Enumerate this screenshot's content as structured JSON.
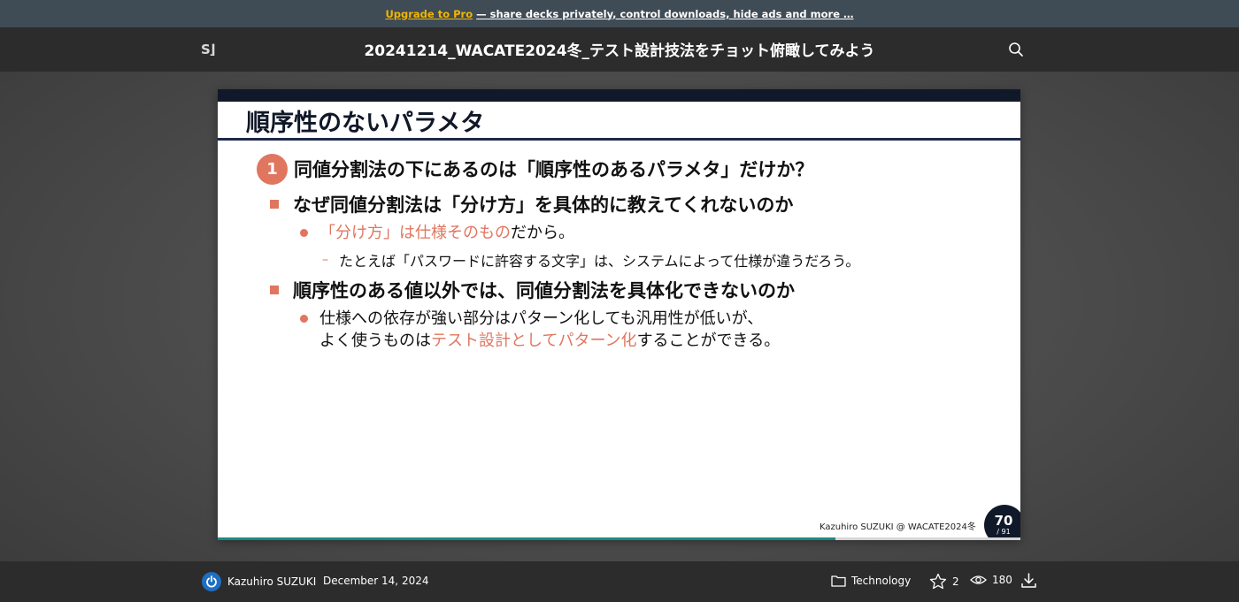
{
  "promo": {
    "upgrade_label": "Upgrade to Pro",
    "rest_label": "— share decks privately, control downloads, hide ads and more …"
  },
  "header": {
    "logo_text": "S⌋",
    "title": "20241214_WACATE2024冬_テスト設計技法をチョット俯瞰してみよう",
    "search_icon": "search-icon"
  },
  "slide": {
    "title": "順序性のないパラメタ",
    "point_number": "1",
    "point_text": "同値分割法の下にあるのは「順序性のあるパラメタ」だけか？",
    "bullet1": "なぜ同値分割法は「分け方」を具体的に教えてくれないのか",
    "bullet1_sub_accent": "「分け方」は仕様そのもの",
    "bullet1_sub_rest": "だから。",
    "bullet1_dash": "–",
    "bullet1_subsub": "たとえば「パスワードに許容する文字」は、システムによって仕様が違うだろう。",
    "bullet2": "順序性のある値以外では、同値分割法を具体化できないのか",
    "bullet2_sub_line1": "仕様への依存が強い部分はパターン化しても汎用性が低いが、",
    "bullet2_sub_line2_pre": "よく使うものは",
    "bullet2_sub_line2_accent": "テスト設計としてパターン化",
    "bullet2_sub_line2_post": "することができる。",
    "footer": "Kazuhiro SUZUKI @ WACATE2024冬",
    "page_current": "70",
    "page_total": "/ 91",
    "progress_fraction": 0.7692,
    "accent_color": "#e0765f",
    "progress_color": "#1b8a86"
  },
  "bottom": {
    "author": "Kazuhiro SUZUKI",
    "date": "December 14, 2024",
    "category": "Technology",
    "stars": "2",
    "views": "180",
    "icons": [
      "avatar",
      "folder-icon",
      "star-icon",
      "eye-icon",
      "download-icon"
    ]
  }
}
